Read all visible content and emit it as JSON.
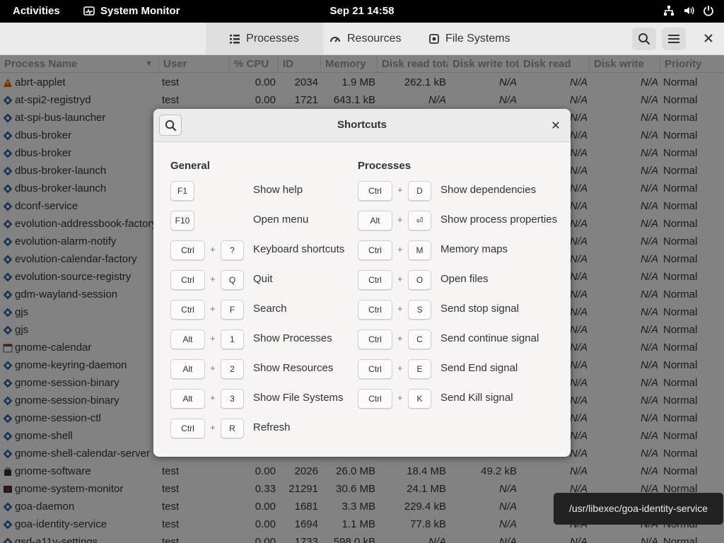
{
  "topbar": {
    "activities": "Activities",
    "app_name": "System Monitor",
    "clock": "Sep 21  14:58"
  },
  "header": {
    "tabs": [
      {
        "label": "Processes",
        "icon": "list-icon",
        "active": true
      },
      {
        "label": "Resources",
        "icon": "gauge-icon",
        "active": false
      },
      {
        "label": "File Systems",
        "icon": "disk-icon",
        "active": false
      }
    ]
  },
  "columns": [
    "Process Name",
    "User",
    "% CPU",
    "ID",
    "Memory",
    "Disk read tota",
    "Disk write tot",
    "Disk read",
    "Disk write",
    "Priority"
  ],
  "processes": [
    {
      "name": "abrt-applet",
      "user": "test",
      "cpu": "0.00",
      "pid": "2034",
      "mem": "1.9 MB",
      "drt": "262.1 kB",
      "dwt": "N/A",
      "dr": "N/A",
      "dw": "N/A",
      "prio": "Normal",
      "icon": "alert"
    },
    {
      "name": "at-spi2-registryd",
      "user": "test",
      "cpu": "0.00",
      "pid": "1721",
      "mem": "643.1 kB",
      "drt": "N/A",
      "dwt": "N/A",
      "dr": "N/A",
      "dw": "N/A",
      "prio": "Normal",
      "icon": "gear"
    },
    {
      "name": "at-spi-bus-launcher",
      "user": "",
      "cpu": "",
      "pid": "",
      "mem": "",
      "drt": "",
      "dwt": "",
      "dr": "N/A",
      "dw": "N/A",
      "prio": "Normal",
      "icon": "gear"
    },
    {
      "name": "dbus-broker",
      "user": "",
      "cpu": "",
      "pid": "",
      "mem": "",
      "drt": "",
      "dwt": "",
      "dr": "N/A",
      "dw": "N/A",
      "prio": "Normal",
      "icon": "gear"
    },
    {
      "name": "dbus-broker",
      "user": "",
      "cpu": "",
      "pid": "",
      "mem": "",
      "drt": "",
      "dwt": "",
      "dr": "N/A",
      "dw": "N/A",
      "prio": "Normal",
      "icon": "gear"
    },
    {
      "name": "dbus-broker-launch",
      "user": "",
      "cpu": "",
      "pid": "",
      "mem": "",
      "drt": "",
      "dwt": "",
      "dr": "N/A",
      "dw": "N/A",
      "prio": "Normal",
      "icon": "gear"
    },
    {
      "name": "dbus-broker-launch",
      "user": "",
      "cpu": "",
      "pid": "",
      "mem": "",
      "drt": "",
      "dwt": "",
      "dr": "N/A",
      "dw": "N/A",
      "prio": "Normal",
      "icon": "gear"
    },
    {
      "name": "dconf-service",
      "user": "",
      "cpu": "",
      "pid": "",
      "mem": "",
      "drt": "",
      "dwt": "",
      "dr": "N/A",
      "dw": "N/A",
      "prio": "Normal",
      "icon": "gear"
    },
    {
      "name": "evolution-addressbook-factory",
      "user": "",
      "cpu": "",
      "pid": "",
      "mem": "",
      "drt": "",
      "dwt": "",
      "dr": "N/A",
      "dw": "N/A",
      "prio": "Normal",
      "icon": "gear"
    },
    {
      "name": "evolution-alarm-notify",
      "user": "",
      "cpu": "",
      "pid": "",
      "mem": "",
      "drt": "",
      "dwt": "",
      "dr": "N/A",
      "dw": "N/A",
      "prio": "Normal",
      "icon": "gear"
    },
    {
      "name": "evolution-calendar-factory",
      "user": "",
      "cpu": "",
      "pid": "",
      "mem": "",
      "drt": "",
      "dwt": "",
      "dr": "N/A",
      "dw": "N/A",
      "prio": "Normal",
      "icon": "gear"
    },
    {
      "name": "evolution-source-registry",
      "user": "",
      "cpu": "",
      "pid": "",
      "mem": "",
      "drt": "",
      "dwt": "",
      "dr": "N/A",
      "dw": "N/A",
      "prio": "Normal",
      "icon": "gear"
    },
    {
      "name": "gdm-wayland-session",
      "user": "",
      "cpu": "",
      "pid": "",
      "mem": "",
      "drt": "",
      "dwt": "",
      "dr": "N/A",
      "dw": "N/A",
      "prio": "Normal",
      "icon": "gear"
    },
    {
      "name": "gjs",
      "user": "",
      "cpu": "",
      "pid": "",
      "mem": "",
      "drt": "",
      "dwt": "",
      "dr": "N/A",
      "dw": "N/A",
      "prio": "Normal",
      "icon": "gear"
    },
    {
      "name": "gjs",
      "user": "",
      "cpu": "",
      "pid": "",
      "mem": "",
      "drt": "",
      "dwt": "",
      "dr": "N/A",
      "dw": "N/A",
      "prio": "Normal",
      "icon": "gear"
    },
    {
      "name": "gnome-calendar",
      "user": "",
      "cpu": "",
      "pid": "",
      "mem": "",
      "drt": "",
      "dwt": "",
      "dr": "N/A",
      "dw": "N/A",
      "prio": "Normal",
      "icon": "calendar"
    },
    {
      "name": "gnome-keyring-daemon",
      "user": "",
      "cpu": "",
      "pid": "",
      "mem": "",
      "drt": "",
      "dwt": "",
      "dr": "N/A",
      "dw": "N/A",
      "prio": "Normal",
      "icon": "gear"
    },
    {
      "name": "gnome-session-binary",
      "user": "",
      "cpu": "",
      "pid": "",
      "mem": "",
      "drt": "",
      "dwt": "",
      "dr": "N/A",
      "dw": "N/A",
      "prio": "Normal",
      "icon": "gear"
    },
    {
      "name": "gnome-session-binary",
      "user": "",
      "cpu": "",
      "pid": "",
      "mem": "",
      "drt": "",
      "dwt": "",
      "dr": "N/A",
      "dw": "N/A",
      "prio": "Normal",
      "icon": "gear"
    },
    {
      "name": "gnome-session-ctl",
      "user": "",
      "cpu": "",
      "pid": "",
      "mem": "",
      "drt": "",
      "dwt": "",
      "dr": "N/A",
      "dw": "N/A",
      "prio": "Normal",
      "icon": "gear"
    },
    {
      "name": "gnome-shell",
      "user": "",
      "cpu": "",
      "pid": "",
      "mem": "",
      "drt": "",
      "dwt": "",
      "dr": "N/A",
      "dw": "N/A",
      "prio": "Normal",
      "icon": "gear"
    },
    {
      "name": "gnome-shell-calendar-server",
      "user": "",
      "cpu": "",
      "pid": "",
      "mem": "",
      "drt": "",
      "dwt": "",
      "dr": "N/A",
      "dw": "N/A",
      "prio": "Normal",
      "icon": "gear"
    },
    {
      "name": "gnome-software",
      "user": "test",
      "cpu": "0.00",
      "pid": "2026",
      "mem": "26.0 MB",
      "drt": "18.4 MB",
      "dwt": "49.2 kB",
      "dr": "N/A",
      "dw": "N/A",
      "prio": "Normal",
      "icon": "bag"
    },
    {
      "name": "gnome-system-monitor",
      "user": "test",
      "cpu": "0.33",
      "pid": "21291",
      "mem": "30.6 MB",
      "drt": "24.1 MB",
      "dwt": "N/A",
      "dr": "N/A",
      "dw": "N/A",
      "prio": "Normal",
      "icon": "monitor"
    },
    {
      "name": "goa-daemon",
      "user": "test",
      "cpu": "0.00",
      "pid": "1681",
      "mem": "3.3 MB",
      "drt": "229.4 kB",
      "dwt": "N/A",
      "dr": "N/A",
      "dw": "N/A",
      "prio": "Normal",
      "icon": "gear"
    },
    {
      "name": "goa-identity-service",
      "user": "test",
      "cpu": "0.00",
      "pid": "1694",
      "mem": "1.1 MB",
      "drt": "77.8 kB",
      "dwt": "N/A",
      "dr": "N/A",
      "dw": "N/A",
      "prio": "Normal",
      "icon": "gear"
    },
    {
      "name": "gsd-a11y-settings",
      "user": "test",
      "cpu": "0.00",
      "pid": "1733",
      "mem": "598.0 kB",
      "drt": "N/A",
      "dwt": "N/A",
      "dr": "N/A",
      "dw": "N/A",
      "prio": "Normal",
      "icon": "gear"
    }
  ],
  "dialog": {
    "title": "Shortcuts",
    "general_title": "General",
    "processes_title": "Processes",
    "general": [
      {
        "keys": [
          "F1"
        ],
        "label": "Show help"
      },
      {
        "keys": [
          "F10"
        ],
        "label": "Open menu"
      },
      {
        "keys": [
          "Ctrl",
          "?"
        ],
        "label": "Keyboard shortcuts"
      },
      {
        "keys": [
          "Ctrl",
          "Q"
        ],
        "label": "Quit"
      },
      {
        "keys": [
          "Ctrl",
          "F"
        ],
        "label": "Search"
      },
      {
        "keys": [
          "Alt",
          "1"
        ],
        "label": "Show Processes"
      },
      {
        "keys": [
          "Alt",
          "2"
        ],
        "label": "Show Resources"
      },
      {
        "keys": [
          "Alt",
          "3"
        ],
        "label": "Show File Systems"
      },
      {
        "keys": [
          "Ctrl",
          "R"
        ],
        "label": "Refresh"
      }
    ],
    "processes": [
      {
        "keys": [
          "Ctrl",
          "D"
        ],
        "label": "Show dependencies"
      },
      {
        "keys": [
          "Alt",
          "⏎"
        ],
        "label": "Show process properties"
      },
      {
        "keys": [
          "Ctrl",
          "M"
        ],
        "label": "Memory maps"
      },
      {
        "keys": [
          "Ctrl",
          "O"
        ],
        "label": "Open files"
      },
      {
        "keys": [
          "Ctrl",
          "S"
        ],
        "label": "Send stop signal"
      },
      {
        "keys": [
          "Ctrl",
          "C"
        ],
        "label": "Send continue signal"
      },
      {
        "keys": [
          "Ctrl",
          "E"
        ],
        "label": "Send End signal"
      },
      {
        "keys": [
          "Ctrl",
          "K"
        ],
        "label": "Send Kill signal"
      }
    ]
  },
  "tooltip": "/usr/libexec/goa-identity-service",
  "colors": {
    "topbar": "#000000",
    "header": "#ebebeb",
    "dialog": "#f6f5f4",
    "gear_icon": "#3565a6"
  }
}
